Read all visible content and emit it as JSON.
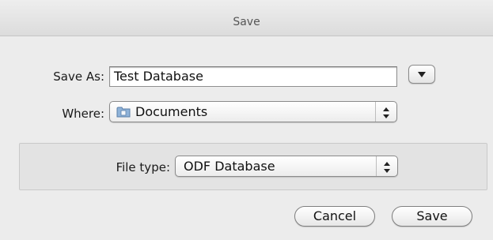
{
  "window": {
    "title": "Save"
  },
  "save_as": {
    "label": "Save As:",
    "value": "Test Database"
  },
  "where": {
    "label": "Where:",
    "value": "Documents",
    "icon": "folder-icon"
  },
  "file_type": {
    "label": "File type:",
    "value": "ODF Database"
  },
  "buttons": {
    "cancel": "Cancel",
    "save": "Save"
  }
}
